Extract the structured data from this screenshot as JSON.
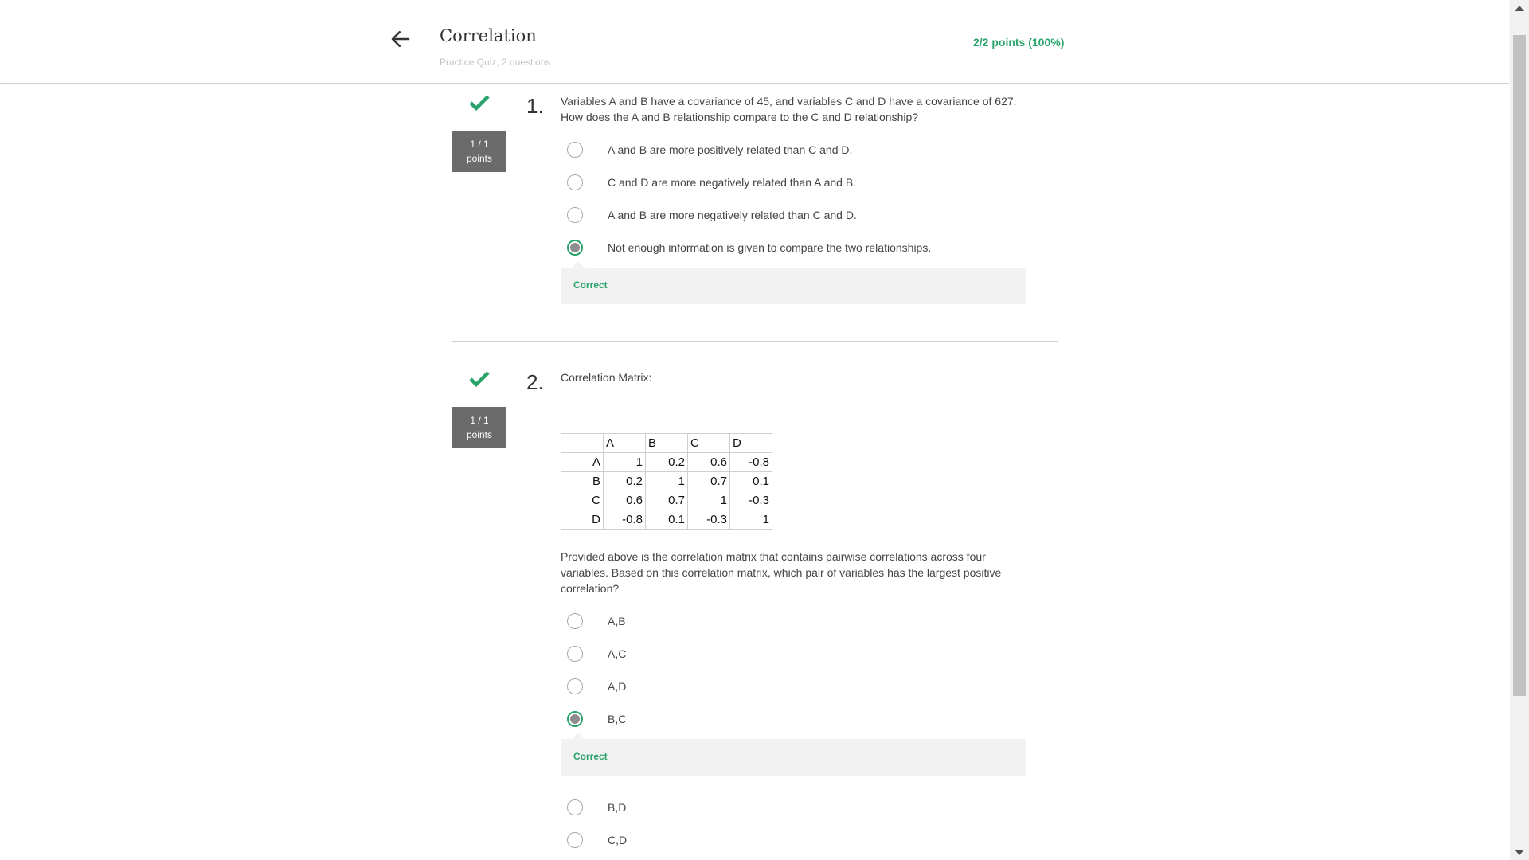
{
  "header": {
    "title": "Correlation",
    "subtitle": "Practice Quiz, 2 questions",
    "score": "2/2 points (100%)"
  },
  "colors": {
    "accent": "#2aa36b",
    "badge": "#6b6b6b"
  },
  "questions": [
    {
      "number": "1.",
      "points_line1": "1 / 1",
      "points_line2": "points",
      "text": "Variables A and B have a covariance of 45, and variables C and D have a covariance of 627. How does the A and B relationship compare to the C and D relationship?",
      "options": [
        "A and B are more positively related than C and D.",
        "C and D are more negatively related than A and B.",
        "A and B are more negatively related than C and D.",
        "Not enough information is given to compare the two relationships."
      ],
      "selected_index": 3,
      "feedback": "Correct"
    },
    {
      "number": "2.",
      "points_line1": "1 / 1",
      "points_line2": "points",
      "title": "Correlation Matrix:",
      "matrix": {
        "columns": [
          "",
          "A",
          "B",
          "C",
          "D"
        ],
        "rows": [
          [
            "A",
            "1",
            "0.2",
            "0.6",
            "-0.8"
          ],
          [
            "B",
            "0.2",
            "1",
            "0.7",
            "0.1"
          ],
          [
            "C",
            "0.6",
            "0.7",
            "1",
            "-0.3"
          ],
          [
            "D",
            "-0.8",
            "0.1",
            "-0.3",
            "1"
          ]
        ]
      },
      "text": "Provided above is the correlation matrix that contains pairwise correlations across four variables. Based on this correlation matrix, which pair of variables has the largest positive correlation?",
      "options": [
        "A,B",
        "A,C",
        "A,D",
        "B,C",
        "B,D",
        "C,D"
      ],
      "selected_index": 3,
      "feedback": "Correct"
    }
  ]
}
